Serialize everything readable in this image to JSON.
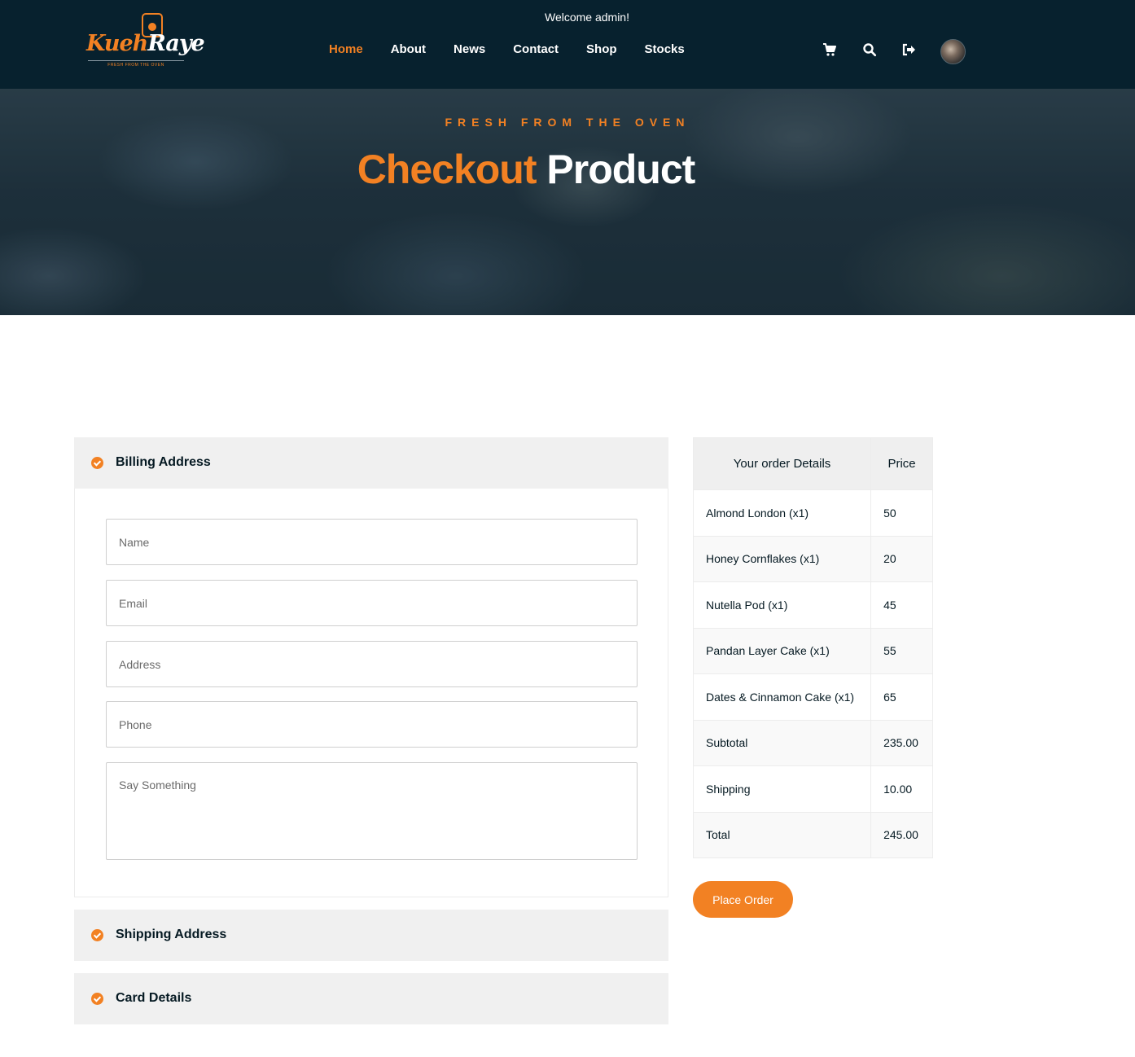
{
  "header": {
    "welcome": "Welcome admin!",
    "logo": {
      "brand_first": "Kueh",
      "brand_second": "Raye",
      "tagline": "FRESH FROM THE OVEN"
    },
    "nav": [
      {
        "label": "Home",
        "active": true
      },
      {
        "label": "About",
        "active": false
      },
      {
        "label": "News",
        "active": false
      },
      {
        "label": "Contact",
        "active": false
      },
      {
        "label": "Shop",
        "active": false
      },
      {
        "label": "Stocks",
        "active": false
      }
    ],
    "icons": [
      "cart-icon",
      "search-icon",
      "sign-out-icon"
    ],
    "accent_color": "#f28123",
    "bar_color": "#07212e"
  },
  "hero": {
    "subtitle": "FRESH FROM THE OVEN",
    "title_highlight": "Checkout",
    "title_rest": "Product"
  },
  "billing": {
    "title": "Billing Address",
    "name_placeholder": "Name",
    "email_placeholder": "Email",
    "address_placeholder": "Address",
    "phone_placeholder": "Phone",
    "message_placeholder": "Say Something"
  },
  "shipping": {
    "title": "Shipping Address"
  },
  "card": {
    "title": "Card Details"
  },
  "order": {
    "col_details": "Your order Details",
    "col_price": "Price",
    "rows": [
      {
        "item": "Almond London (x1)",
        "price": "50"
      },
      {
        "item": "Honey Cornflakes (x1)",
        "price": "20"
      },
      {
        "item": "Nutella Pod (x1)",
        "price": "45"
      },
      {
        "item": "Pandan Layer Cake (x1)",
        "price": "55"
      },
      {
        "item": "Dates & Cinnamon Cake (x1)",
        "price": "65"
      },
      {
        "item": "Subtotal",
        "price": "235.00"
      },
      {
        "item": "Shipping",
        "price": "10.00"
      },
      {
        "item": "Total",
        "price": "245.00"
      }
    ],
    "place_order_label": "Place Order"
  }
}
